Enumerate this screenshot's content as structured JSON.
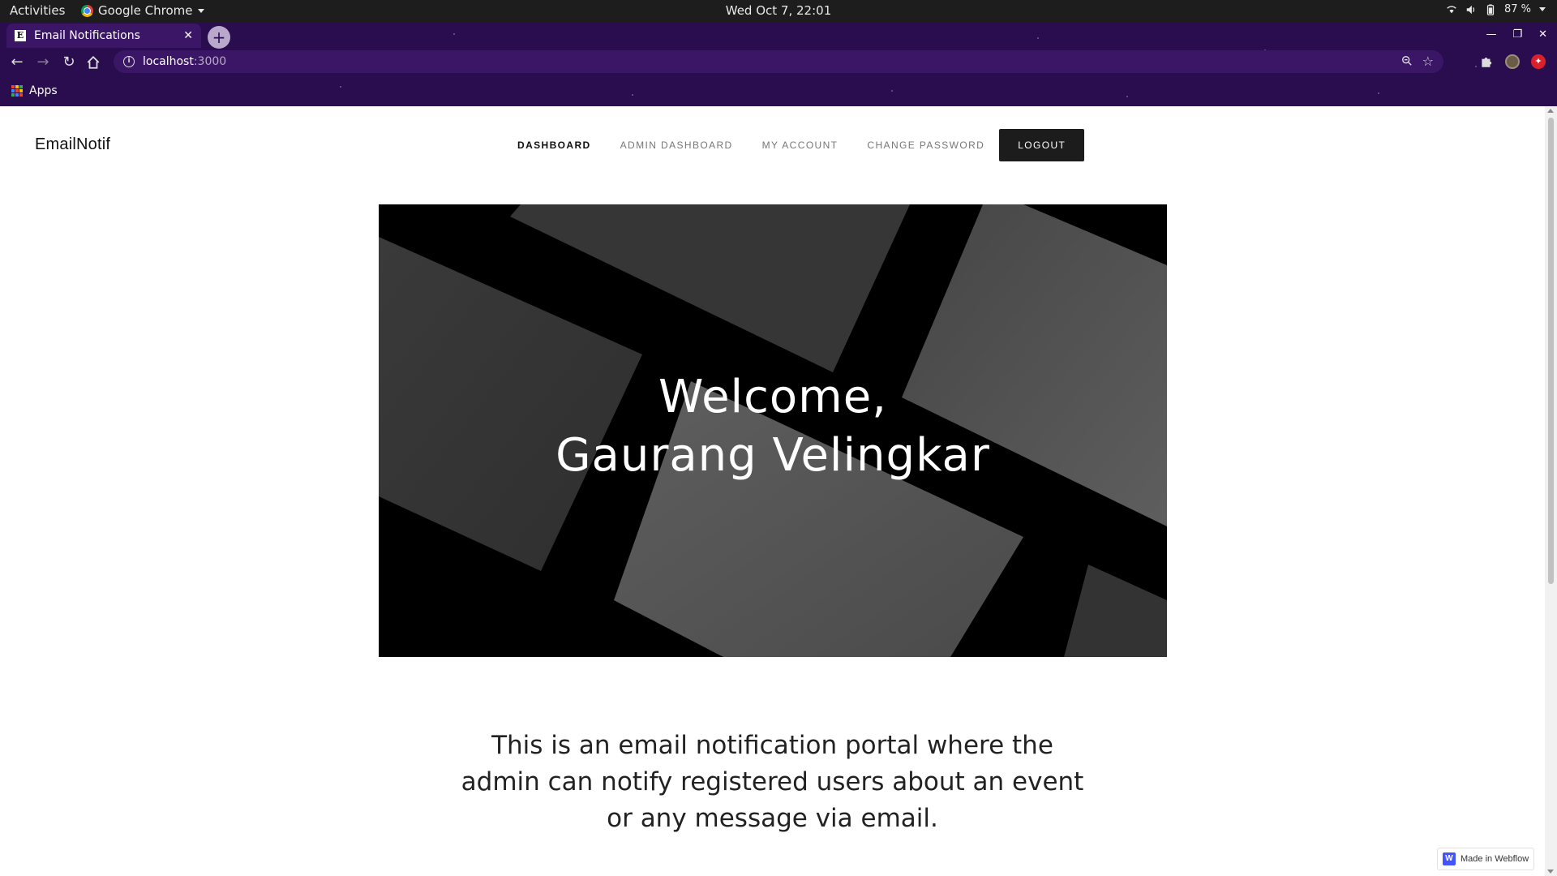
{
  "os_bar": {
    "activities": "Activities",
    "app_name": "Google Chrome",
    "clock": "Wed Oct  7, 22:01",
    "battery": "87 %"
  },
  "browser": {
    "tab_title": "Email Notifications",
    "favicon_letter": "E",
    "url_host": "localhost",
    "url_port": ":3000",
    "bookmark_apps": "Apps",
    "theme_color": "#2a0d4e"
  },
  "site": {
    "brand": "EmailNotif",
    "nav": {
      "dashboard": "DASHBOARD",
      "admin_dashboard": "ADMIN DASHBOARD",
      "my_account": "MY ACCOUNT",
      "change_password": "CHANGE PASSWORD",
      "logout": "LOGOUT"
    },
    "hero": {
      "line1": "Welcome,",
      "line2": "Gaurang Velingkar"
    },
    "description": "This is an email notification portal where the admin can notify registered users about an event or any message via email.",
    "webflow_badge": "Made in Webflow",
    "accent_dark": "#1c1c1c"
  }
}
